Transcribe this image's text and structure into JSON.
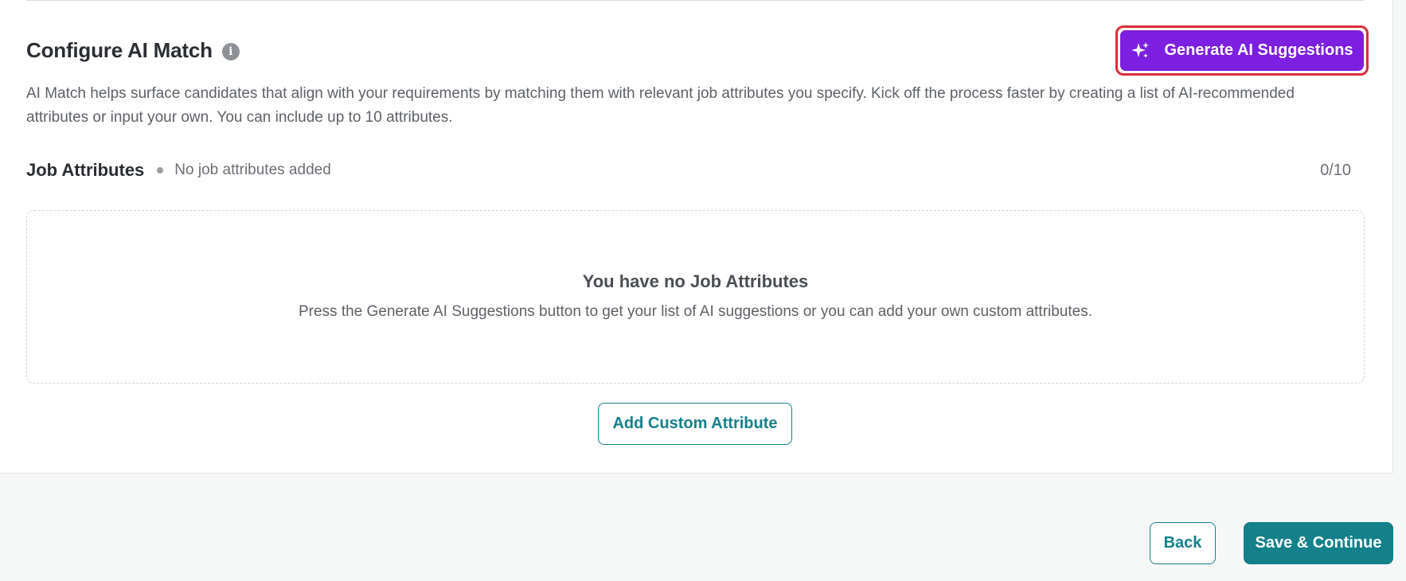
{
  "section": {
    "title": "Configure AI Match",
    "info_icon": "info-icon",
    "generate_button": {
      "label": "Generate AI Suggestions",
      "icon": "sparkle-icon",
      "color": "#7c1fe0",
      "highlight_color": "#d92d3a"
    },
    "description": "AI Match helps surface candidates that align with your requirements by matching them with relevant job attributes you specify. Kick off the process faster by creating a list of AI-recommended attributes or input your own. You can include up to 10 attributes."
  },
  "job_attributes": {
    "title": "Job Attributes",
    "status": "No job attributes added",
    "count": "0/10",
    "empty_state": {
      "title": "You have no Job Attributes",
      "message": "Press the Generate AI Suggestions button to get your list of AI suggestions or you can add your own custom attributes."
    },
    "add_button_label": "Add Custom Attribute"
  },
  "footer": {
    "back_label": "Back",
    "save_label": "Save & Continue",
    "accent_color": "#13808a"
  }
}
